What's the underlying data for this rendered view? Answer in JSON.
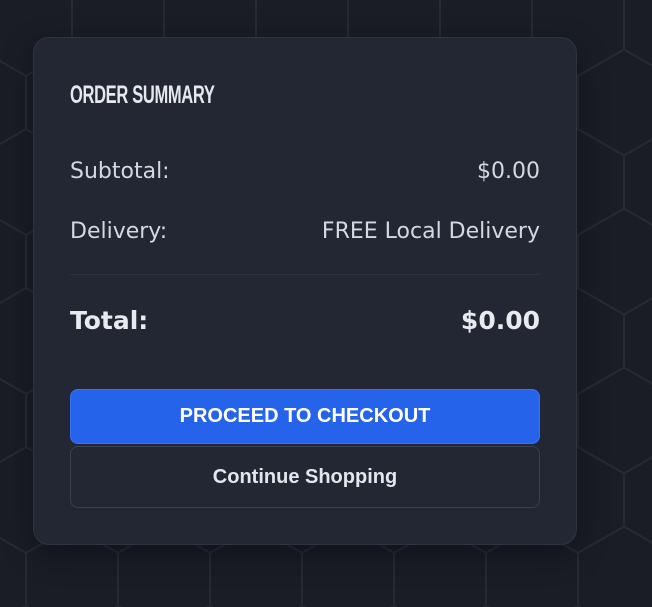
{
  "summary": {
    "title": "ORDER SUMMARY",
    "subtotal_label": "Subtotal:",
    "subtotal_value": "$0.00",
    "delivery_label": "Delivery:",
    "delivery_value": "FREE Local Delivery",
    "total_label": "Total:",
    "total_value": "$0.00"
  },
  "actions": {
    "checkout_label": "PROCEED TO CHECKOUT",
    "continue_label": "Continue Shopping"
  },
  "colors": {
    "background": "#1a1d26",
    "card": "#232734",
    "accent": "#2563eb"
  }
}
